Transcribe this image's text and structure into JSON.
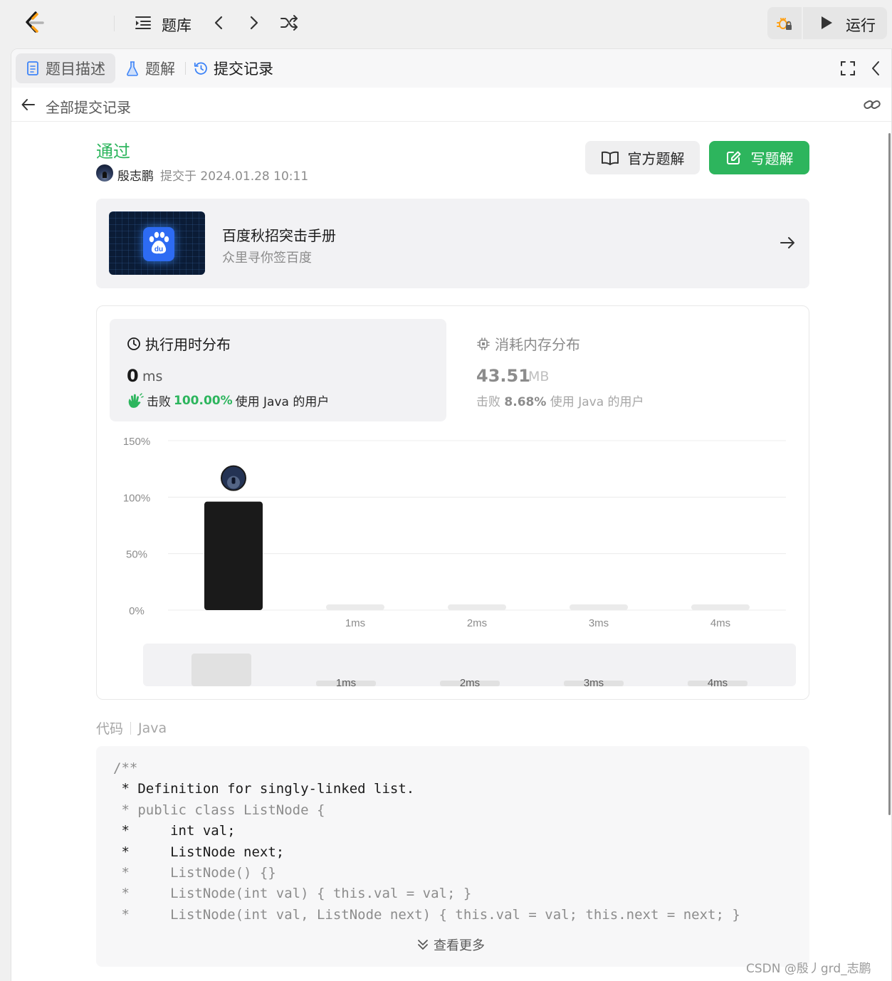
{
  "topbar": {
    "problem_list_label": "题库",
    "run_label": "运行"
  },
  "tabs": [
    {
      "label": "题目描述"
    },
    {
      "label": "题解"
    },
    {
      "label": "提交记录"
    }
  ],
  "subheader": {
    "back_label": "全部提交记录"
  },
  "submission": {
    "status": "通过",
    "author": "殷志鹏",
    "submitted_at": "提交于 2024.01.28 10:11",
    "official_solution_label": "官方题解",
    "write_solution_label": "写题解"
  },
  "ad": {
    "title": "百度秋招突击手册",
    "subtitle": "众里寻你签百度"
  },
  "runtime": {
    "title": "执行用时分布",
    "value": "0",
    "unit": "ms",
    "beat_prefix": "击败",
    "beat_percent": "100.00%",
    "beat_suffix": "使用 Java 的用户"
  },
  "memory": {
    "title": "消耗内存分布",
    "value": "43.51",
    "unit": "MB",
    "beat_prefix": "击败",
    "beat_percent": "8.68%",
    "beat_suffix": "使用 Java 的用户"
  },
  "chart_data": {
    "type": "bar",
    "categories": [
      "0ms",
      "1ms",
      "2ms",
      "3ms",
      "4ms"
    ],
    "tick_labels": [
      "",
      "1ms",
      "2ms",
      "3ms",
      "4ms"
    ],
    "values": [
      96,
      0,
      0,
      0,
      0
    ],
    "ylim": [
      0,
      150
    ],
    "yticks": [
      "0%",
      "50%",
      "100%",
      "150%"
    ],
    "highlight_index": 0,
    "grid": true,
    "colors": {
      "highlight": "#1a1a1a",
      "bar": "#ebebeb",
      "grid": "#ececec"
    },
    "navigator_labels": [
      "1ms",
      "2ms",
      "3ms",
      "4ms"
    ]
  },
  "code": {
    "label": "代码",
    "language": "Java",
    "lines": [
      {
        "text": "/**",
        "dim": true
      },
      {
        "text": " * Definition for singly-linked list.",
        "dim": false
      },
      {
        "text": " * public class ListNode {",
        "dim": true
      },
      {
        "text": " *     int val;",
        "dim": false
      },
      {
        "text": " *     ListNode next;",
        "dim": false
      },
      {
        "text": " *     ListNode() {}",
        "dim": true
      },
      {
        "text": " *     ListNode(int val) { this.val = val; }",
        "dim": true
      },
      {
        "text": " *     ListNode(int val, ListNode next) { this.val = val; this.next = next; }",
        "dim": true
      }
    ],
    "show_more_label": "查看更多"
  },
  "watermark": "CSDN @殷丿grd_志鹏",
  "colors": {
    "accent_green": "#2db55d"
  }
}
